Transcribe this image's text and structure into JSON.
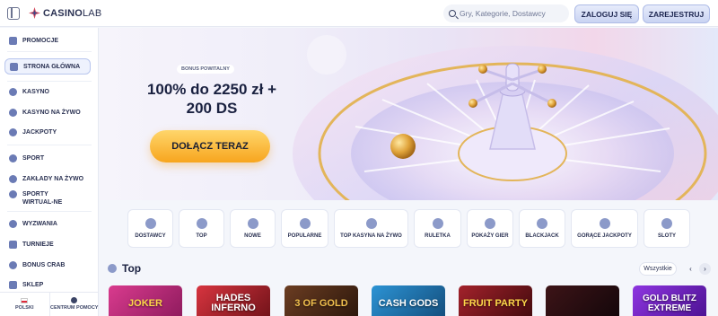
{
  "header": {
    "logo_bold": "CASINO",
    "logo_thin": "LAB",
    "search_placeholder": "Gry, Kategorie, Dostawcy",
    "login_label": "ZALOGUJ SIĘ",
    "register_label": "ZAREJESTRUJ"
  },
  "sidebar": {
    "items": [
      {
        "label": "PROMOCJE",
        "icon": "gift-icon"
      },
      {
        "label": "STRONA GŁÓWNA",
        "icon": "home-icon"
      },
      {
        "label": "KASYNO",
        "icon": "cherry-icon"
      },
      {
        "label": "KASYNO NA ŻYWO",
        "icon": "dealer-icon"
      },
      {
        "label": "JACKPOTY",
        "icon": "trophy-icon"
      },
      {
        "label": "SPORT",
        "icon": "ball-icon"
      },
      {
        "label": "ZAKŁADY NA ŻYWO",
        "icon": "live-icon"
      },
      {
        "label": "SPORTY WIRTUAL-NE",
        "icon": "virtual-icon"
      },
      {
        "label": "WYZWANIA",
        "icon": "target-icon"
      },
      {
        "label": "TURNIEJE",
        "icon": "cup-icon"
      },
      {
        "label": "BONUS CRAB",
        "icon": "crab-icon"
      },
      {
        "label": "SKLEP",
        "icon": "shop-icon"
      }
    ],
    "language": "POLSKI",
    "help": "CENTRUM POMOCY"
  },
  "hero": {
    "bonus_badge": "BONUS POWITALNY",
    "title_line1": "100% do 2250 zł +",
    "title_line2": "200 DS",
    "cta": "DOŁĄCZ TERAZ"
  },
  "categories": [
    {
      "label": "DOSTAWCY",
      "icon": "funnel-icon"
    },
    {
      "label": "TOP",
      "icon": "star-burst-icon"
    },
    {
      "label": "NOWE",
      "icon": "new-icon"
    },
    {
      "label": "POPULARNE",
      "icon": "star-icon"
    },
    {
      "label": "TOP KASYNA NA ŻYWO",
      "icon": "star-live-icon"
    },
    {
      "label": "RULETKA",
      "icon": "roulette-icon"
    },
    {
      "label": "POKAŻY GIER",
      "icon": "games-icon"
    },
    {
      "label": "BLACKJACK",
      "icon": "cards-icon"
    },
    {
      "label": "GORĄCE JACKPOTY",
      "icon": "jackpot-icon"
    },
    {
      "label": "SLOTY",
      "icon": "slots-icon"
    }
  ],
  "top_section": {
    "title": "Top",
    "all_label": "Wszystkie",
    "prev": "‹",
    "next": "›"
  },
  "games": [
    {
      "title": "JOKER",
      "color": "#c81f7a"
    },
    {
      "title": "HADES INFERNO",
      "color": "#b9222f"
    },
    {
      "title": "3 OF GOLD",
      "color": "#4a2a18"
    },
    {
      "title": "CASH GODS",
      "color": "#1e6ea8"
    },
    {
      "title": "FRUIT PARTY",
      "color": "#6b1118"
    },
    {
      "title": "",
      "color": "#2a0d10"
    },
    {
      "title": "GOLD BLITZ EXTREME",
      "color": "#6a1fb6"
    }
  ]
}
